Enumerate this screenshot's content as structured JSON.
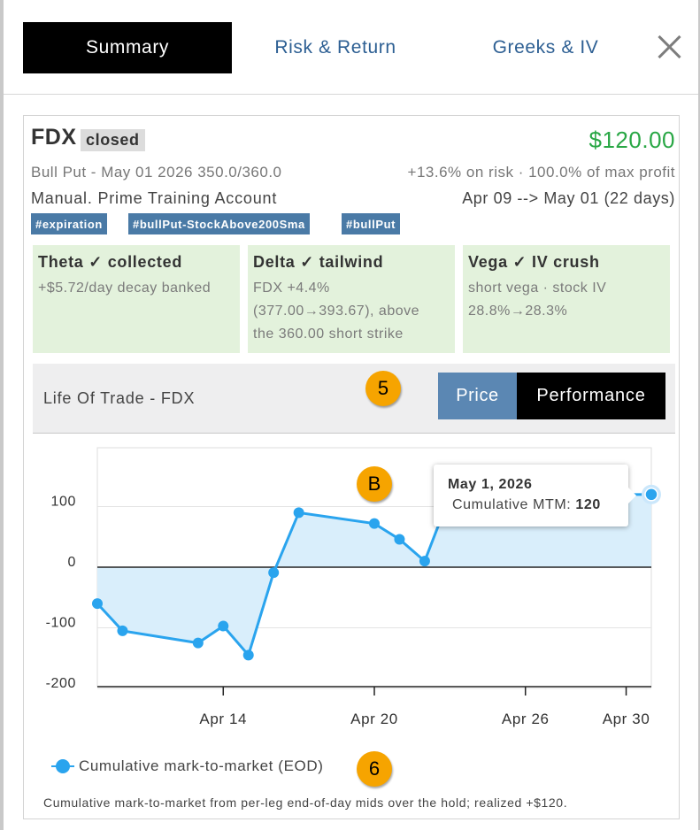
{
  "tabs": [
    {
      "label": "Summary",
      "active": true
    },
    {
      "label": "Risk & Return",
      "active": false
    },
    {
      "label": "Greeks & IV",
      "active": false
    }
  ],
  "trade": {
    "symbol": "FDX",
    "status": "closed",
    "pnl": "$120.00",
    "description": "Bull Put - May 01 2026 350.0/360.0",
    "return_summary": "+13.6% on risk · 100.0% of max profit",
    "account": "Manual. Prime Training Account",
    "dates": "Apr 09 --> May 01 (22 days)",
    "tags": [
      "#expiration",
      "#bullPut-StockAbove200Sma",
      "#bullPut"
    ]
  },
  "greeks": [
    {
      "title": "Theta ✓ collected",
      "lines": [
        "+$5.72/day decay banked"
      ]
    },
    {
      "title": "Delta ✓ tailwind",
      "lines": [
        "FDX +4.4%",
        "(377.00→393.67), above",
        "the 360.00 short strike"
      ]
    },
    {
      "title": "Vega ✓ IV crush",
      "lines": [
        "short vega · stock IV",
        "28.8%→28.3%"
      ]
    }
  ],
  "life_of_trade": {
    "title": "Life Of Trade - FDX",
    "price_button": "Price",
    "performance_button": "Performance"
  },
  "badges": {
    "five": "5",
    "b": "B",
    "six": "6"
  },
  "tooltip": {
    "date": "May 1, 2026",
    "label": "Cumulative MTM:",
    "value": "120"
  },
  "legend": {
    "label": "Cumulative mark-to-market (EOD)"
  },
  "footnote": "Cumulative mark-to-market from per-leg end-of-day mids over the hold; realized +$120.",
  "colors": {
    "series": "#2aa4ee",
    "area": "#d9eefb",
    "pnl_positive": "#29a745",
    "badge": "#f6a400"
  },
  "chart_data": {
    "type": "area",
    "series": [
      {
        "name": "Cumulative mark-to-market (EOD)",
        "x": [
          "2026-04-09",
          "2026-04-10",
          "2026-04-13",
          "2026-04-14",
          "2026-04-15",
          "2026-04-16",
          "2026-04-17",
          "2026-04-20",
          "2026-04-21",
          "2026-04-22",
          "2026-04-23",
          "2026-05-01"
        ],
        "y": [
          -60,
          -105,
          -125,
          -97,
          -145,
          -9,
          90,
          72,
          46,
          10,
          118,
          120
        ]
      }
    ],
    "yticks": [
      -200,
      -100,
      0,
      100
    ],
    "xticks": [
      "Apr 14",
      "Apr 20",
      "Apr 26",
      "Apr 30"
    ],
    "ylim": [
      -200,
      145
    ],
    "grid": true,
    "legend": "bottom-left"
  }
}
